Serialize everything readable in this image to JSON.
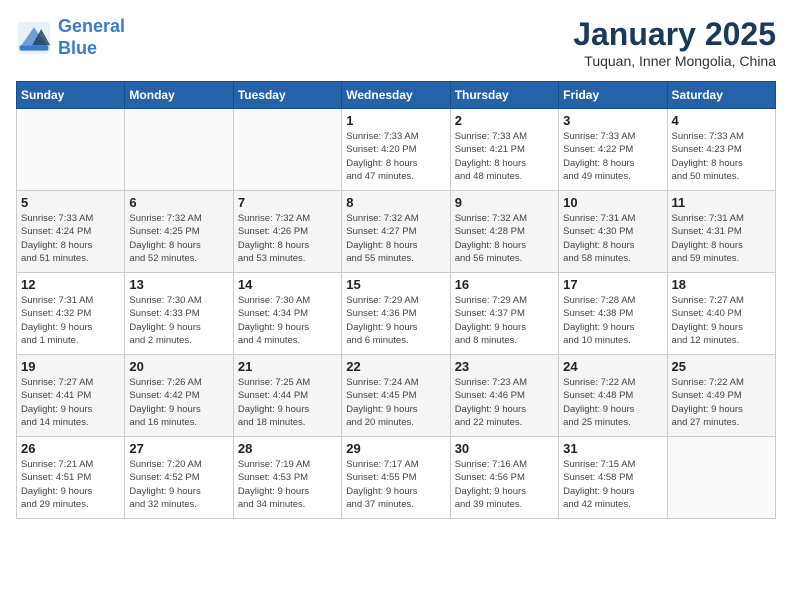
{
  "header": {
    "logo_line1": "General",
    "logo_line2": "Blue",
    "month": "January 2025",
    "location": "Tuquan, Inner Mongolia, China"
  },
  "weekdays": [
    "Sunday",
    "Monday",
    "Tuesday",
    "Wednesday",
    "Thursday",
    "Friday",
    "Saturday"
  ],
  "weeks": [
    [
      {
        "day": "",
        "info": ""
      },
      {
        "day": "",
        "info": ""
      },
      {
        "day": "",
        "info": ""
      },
      {
        "day": "1",
        "info": "Sunrise: 7:33 AM\nSunset: 4:20 PM\nDaylight: 8 hours\nand 47 minutes."
      },
      {
        "day": "2",
        "info": "Sunrise: 7:33 AM\nSunset: 4:21 PM\nDaylight: 8 hours\nand 48 minutes."
      },
      {
        "day": "3",
        "info": "Sunrise: 7:33 AM\nSunset: 4:22 PM\nDaylight: 8 hours\nand 49 minutes."
      },
      {
        "day": "4",
        "info": "Sunrise: 7:33 AM\nSunset: 4:23 PM\nDaylight: 8 hours\nand 50 minutes."
      }
    ],
    [
      {
        "day": "5",
        "info": "Sunrise: 7:33 AM\nSunset: 4:24 PM\nDaylight: 8 hours\nand 51 minutes."
      },
      {
        "day": "6",
        "info": "Sunrise: 7:32 AM\nSunset: 4:25 PM\nDaylight: 8 hours\nand 52 minutes."
      },
      {
        "day": "7",
        "info": "Sunrise: 7:32 AM\nSunset: 4:26 PM\nDaylight: 8 hours\nand 53 minutes."
      },
      {
        "day": "8",
        "info": "Sunrise: 7:32 AM\nSunset: 4:27 PM\nDaylight: 8 hours\nand 55 minutes."
      },
      {
        "day": "9",
        "info": "Sunrise: 7:32 AM\nSunset: 4:28 PM\nDaylight: 8 hours\nand 56 minutes."
      },
      {
        "day": "10",
        "info": "Sunrise: 7:31 AM\nSunset: 4:30 PM\nDaylight: 8 hours\nand 58 minutes."
      },
      {
        "day": "11",
        "info": "Sunrise: 7:31 AM\nSunset: 4:31 PM\nDaylight: 8 hours\nand 59 minutes."
      }
    ],
    [
      {
        "day": "12",
        "info": "Sunrise: 7:31 AM\nSunset: 4:32 PM\nDaylight: 9 hours\nand 1 minute."
      },
      {
        "day": "13",
        "info": "Sunrise: 7:30 AM\nSunset: 4:33 PM\nDaylight: 9 hours\nand 2 minutes."
      },
      {
        "day": "14",
        "info": "Sunrise: 7:30 AM\nSunset: 4:34 PM\nDaylight: 9 hours\nand 4 minutes."
      },
      {
        "day": "15",
        "info": "Sunrise: 7:29 AM\nSunset: 4:36 PM\nDaylight: 9 hours\nand 6 minutes."
      },
      {
        "day": "16",
        "info": "Sunrise: 7:29 AM\nSunset: 4:37 PM\nDaylight: 9 hours\nand 8 minutes."
      },
      {
        "day": "17",
        "info": "Sunrise: 7:28 AM\nSunset: 4:38 PM\nDaylight: 9 hours\nand 10 minutes."
      },
      {
        "day": "18",
        "info": "Sunrise: 7:27 AM\nSunset: 4:40 PM\nDaylight: 9 hours\nand 12 minutes."
      }
    ],
    [
      {
        "day": "19",
        "info": "Sunrise: 7:27 AM\nSunset: 4:41 PM\nDaylight: 9 hours\nand 14 minutes."
      },
      {
        "day": "20",
        "info": "Sunrise: 7:26 AM\nSunset: 4:42 PM\nDaylight: 9 hours\nand 16 minutes."
      },
      {
        "day": "21",
        "info": "Sunrise: 7:25 AM\nSunset: 4:44 PM\nDaylight: 9 hours\nand 18 minutes."
      },
      {
        "day": "22",
        "info": "Sunrise: 7:24 AM\nSunset: 4:45 PM\nDaylight: 9 hours\nand 20 minutes."
      },
      {
        "day": "23",
        "info": "Sunrise: 7:23 AM\nSunset: 4:46 PM\nDaylight: 9 hours\nand 22 minutes."
      },
      {
        "day": "24",
        "info": "Sunrise: 7:22 AM\nSunset: 4:48 PM\nDaylight: 9 hours\nand 25 minutes."
      },
      {
        "day": "25",
        "info": "Sunrise: 7:22 AM\nSunset: 4:49 PM\nDaylight: 9 hours\nand 27 minutes."
      }
    ],
    [
      {
        "day": "26",
        "info": "Sunrise: 7:21 AM\nSunset: 4:51 PM\nDaylight: 9 hours\nand 29 minutes."
      },
      {
        "day": "27",
        "info": "Sunrise: 7:20 AM\nSunset: 4:52 PM\nDaylight: 9 hours\nand 32 minutes."
      },
      {
        "day": "28",
        "info": "Sunrise: 7:19 AM\nSunset: 4:53 PM\nDaylight: 9 hours\nand 34 minutes."
      },
      {
        "day": "29",
        "info": "Sunrise: 7:17 AM\nSunset: 4:55 PM\nDaylight: 9 hours\nand 37 minutes."
      },
      {
        "day": "30",
        "info": "Sunrise: 7:16 AM\nSunset: 4:56 PM\nDaylight: 9 hours\nand 39 minutes."
      },
      {
        "day": "31",
        "info": "Sunrise: 7:15 AM\nSunset: 4:58 PM\nDaylight: 9 hours\nand 42 minutes."
      },
      {
        "day": "",
        "info": ""
      }
    ]
  ]
}
